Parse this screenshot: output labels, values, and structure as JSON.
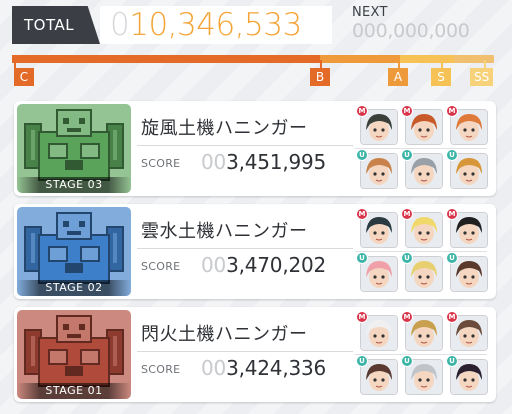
{
  "header": {
    "total_label": "TOTAL",
    "total_value_lead": "0",
    "total_value": "10,346,533",
    "next_label": "NEXT",
    "next_value": "000,000,000"
  },
  "rank_bar": {
    "ranks": [
      "C",
      "B",
      "A",
      "S",
      "SS"
    ],
    "current_rank": "B",
    "progress_fraction": 0.7
  },
  "stages": [
    {
      "stage_label": "STAGE 03",
      "name": "旋風土機ハニンガー",
      "score_label": "SCORE",
      "score_lead": "00",
      "score": "3,451,995",
      "theme_color": "#5aa35a",
      "party": [
        {
          "badge": "M",
          "hair": "#3a3f3a"
        },
        {
          "badge": "M",
          "hair": "#c85a2a"
        },
        {
          "badge": "M",
          "hair": "#e07a3a"
        },
        {
          "badge": "U",
          "hair": "#c8824a"
        },
        {
          "badge": "U",
          "hair": "#9aa0a8"
        },
        {
          "badge": "U",
          "hair": "#d8963a"
        }
      ]
    },
    {
      "stage_label": "STAGE 02",
      "name": "雲水土機ハニンガー",
      "score_label": "SCORE",
      "score_lead": "00",
      "score": "3,470,202",
      "theme_color": "#3d7fc8",
      "party": [
        {
          "badge": "M",
          "hair": "#2a3a40"
        },
        {
          "badge": "M",
          "hair": "#f0d86a"
        },
        {
          "badge": "M",
          "hair": "#202020"
        },
        {
          "badge": "U",
          "hair": "#f0a0a8"
        },
        {
          "badge": "U",
          "hair": "#e8d070"
        },
        {
          "badge": "U",
          "hair": "#5a3a2a"
        }
      ]
    },
    {
      "stage_label": "STAGE 01",
      "name": "閃火土機ハニンガー",
      "score_label": "SCORE",
      "score_lead": "00",
      "score": "3,424,336",
      "theme_color": "#b04a3a",
      "party": [
        {
          "badge": "M",
          "hair": "#f0f0f0"
        },
        {
          "badge": "M",
          "hair": "#c8a050"
        },
        {
          "badge": "M",
          "hair": "#6a4a3a"
        },
        {
          "badge": "U",
          "hair": "#5a3a30"
        },
        {
          "badge": "U",
          "hair": "#c0c4c8"
        },
        {
          "badge": "U",
          "hair": "#2a2030"
        }
      ]
    }
  ]
}
